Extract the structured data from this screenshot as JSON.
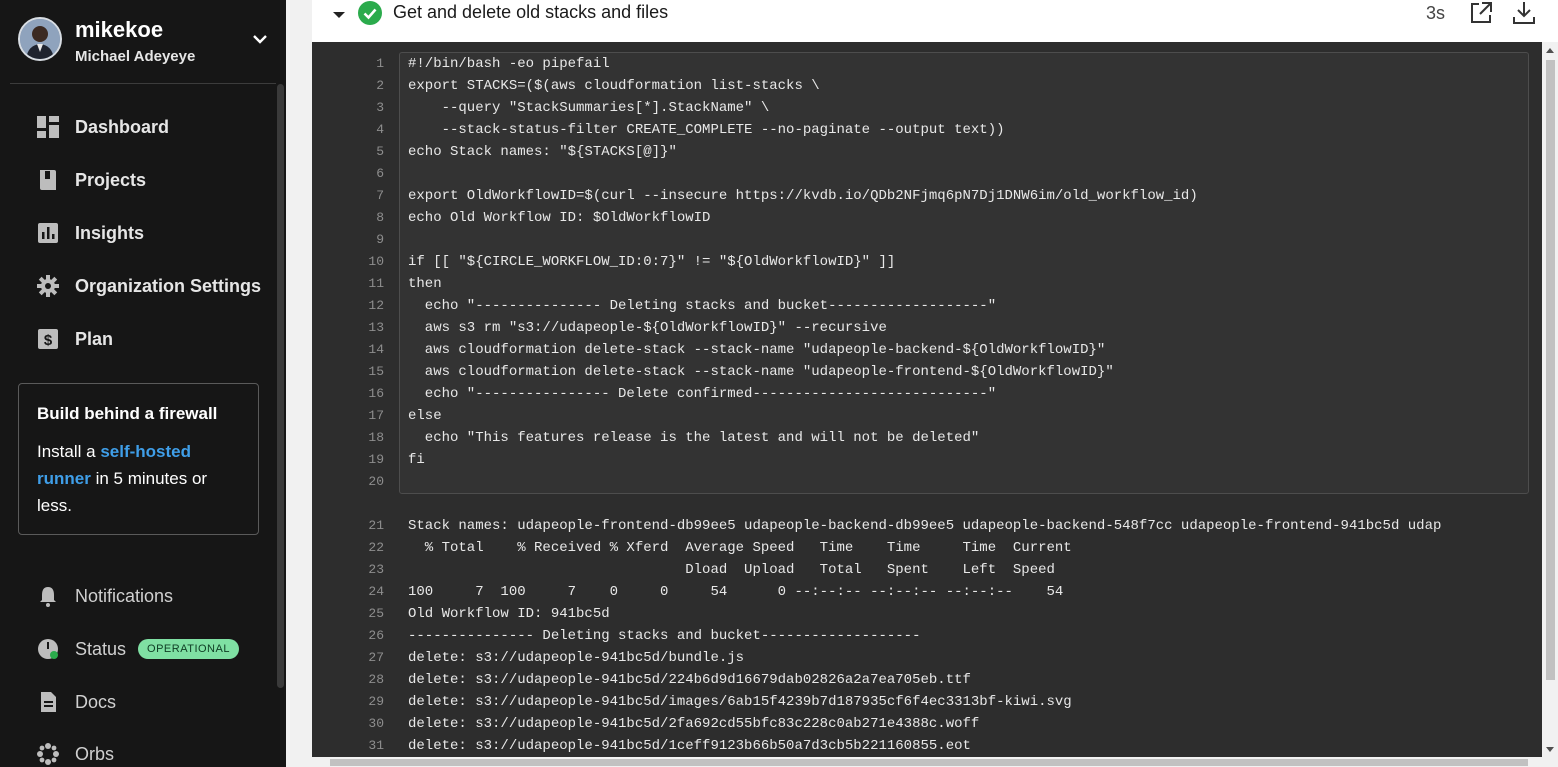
{
  "user": {
    "handle": "mikekoe",
    "full_name": "Michael Adeyeye",
    "menu_icon": "chevron-down-icon"
  },
  "nav": {
    "primary": [
      {
        "label": "Dashboard",
        "icon": "dashboard-icon"
      },
      {
        "label": "Projects",
        "icon": "projects-icon"
      },
      {
        "label": "Insights",
        "icon": "insights-icon"
      },
      {
        "label": "Organization Settings",
        "icon": "gear-icon"
      },
      {
        "label": "Plan",
        "icon": "plan-icon"
      }
    ],
    "secondary": [
      {
        "label": "Notifications",
        "icon": "bell-icon"
      },
      {
        "label": "Status",
        "icon": "status-icon",
        "badge": "OPERATIONAL"
      },
      {
        "label": "Docs",
        "icon": "docs-icon"
      },
      {
        "label": "Orbs",
        "icon": "orbs-icon"
      }
    ]
  },
  "promo": {
    "title": "Build behind a firewall",
    "text_before": "Install a ",
    "link": "self-hosted runner",
    "text_after": " in 5 minutes or less."
  },
  "step": {
    "title": "Get and delete old stacks and files",
    "duration": "3s",
    "status": "success",
    "open_icon": "external-link-icon",
    "download_icon": "download-icon"
  },
  "colors": {
    "sidebar_bg": "#161616",
    "console_bg": "#2d2d2d",
    "success": "#2bab4c",
    "link": "#3f9ee8",
    "badge_bg": "#7fe0a3"
  },
  "script_lines": [
    {
      "n": "1",
      "t": "#!/bin/bash -eo pipefail"
    },
    {
      "n": "2",
      "t": "export STACKS=($(aws cloudformation list-stacks \\"
    },
    {
      "n": "3",
      "t": "    --query \"StackSummaries[*].StackName\" \\"
    },
    {
      "n": "4",
      "t": "    --stack-status-filter CREATE_COMPLETE --no-paginate --output text))"
    },
    {
      "n": "5",
      "t": "echo Stack names: \"${STACKS[@]}\""
    },
    {
      "n": "6",
      "t": ""
    },
    {
      "n": "7",
      "t": "export OldWorkflowID=$(curl --insecure https://kvdb.io/QDb2NFjmq6pN7Dj1DNW6im/old_workflow_id)"
    },
    {
      "n": "8",
      "t": "echo Old Workflow ID: $OldWorkflowID"
    },
    {
      "n": "9",
      "t": ""
    },
    {
      "n": "10",
      "t": "if [[ \"${CIRCLE_WORKFLOW_ID:0:7}\" != \"${OldWorkflowID}\" ]]"
    },
    {
      "n": "11",
      "t": "then"
    },
    {
      "n": "12",
      "t": "  echo \"--------------- Deleting stacks and bucket-------------------\""
    },
    {
      "n": "13",
      "t": "  aws s3 rm \"s3://udapeople-${OldWorkflowID}\" --recursive"
    },
    {
      "n": "14",
      "t": "  aws cloudformation delete-stack --stack-name \"udapeople-backend-${OldWorkflowID}\""
    },
    {
      "n": "15",
      "t": "  aws cloudformation delete-stack --stack-name \"udapeople-frontend-${OldWorkflowID}\""
    },
    {
      "n": "16",
      "t": "  echo \"---------------- Delete confirmed----------------------------\""
    },
    {
      "n": "17",
      "t": "else"
    },
    {
      "n": "18",
      "t": "  echo \"This features release is the latest and will not be deleted\""
    },
    {
      "n": "19",
      "t": "fi"
    },
    {
      "n": "20",
      "t": ""
    }
  ],
  "output_lines": [
    {
      "n": "21",
      "t": "Stack names: udapeople-frontend-db99ee5 udapeople-backend-db99ee5 udapeople-backend-548f7cc udapeople-frontend-941bc5d udap"
    },
    {
      "n": "22",
      "t": "  % Total    % Received % Xferd  Average Speed   Time    Time     Time  Current"
    },
    {
      "n": "23",
      "t": "                                 Dload  Upload   Total   Spent    Left  Speed"
    },
    {
      "n": "24",
      "t": "100     7  100     7    0     0     54      0 --:--:-- --:--:-- --:--:--    54"
    },
    {
      "n": "25",
      "t": "Old Workflow ID: 941bc5d"
    },
    {
      "n": "26",
      "t": "--------------- Deleting stacks and bucket-------------------"
    },
    {
      "n": "27",
      "t": "delete: s3://udapeople-941bc5d/bundle.js"
    },
    {
      "n": "28",
      "t": "delete: s3://udapeople-941bc5d/224b6d9d16679dab02826a2a7ea705eb.ttf"
    },
    {
      "n": "29",
      "t": "delete: s3://udapeople-941bc5d/images/6ab15f4239b7d187935cf6f4ec3313bf-kiwi.svg"
    },
    {
      "n": "30",
      "t": "delete: s3://udapeople-941bc5d/2fa692cd55bfc83c228c0ab271e4388c.woff"
    },
    {
      "n": "31",
      "t": "delete: s3://udapeople-941bc5d/1ceff9123b66b50a7d3cb5b221160855.eot"
    }
  ]
}
